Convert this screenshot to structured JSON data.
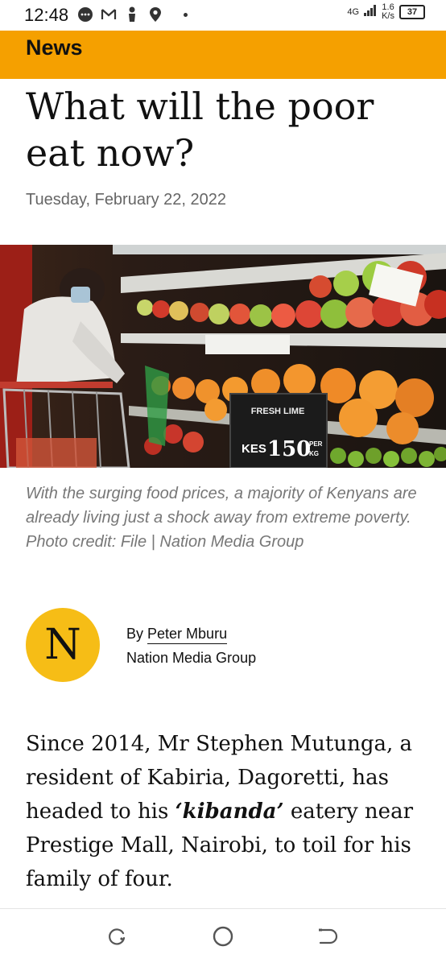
{
  "status_bar": {
    "time": "12:48",
    "network_type": "4G",
    "speed_value": "1.6",
    "speed_unit": "K/s",
    "battery": "37"
  },
  "section": {
    "label": "News"
  },
  "article": {
    "headline": "What will the poor eat now?",
    "date": "Tuesday, February 22, 2022",
    "photo": {
      "sign_title": "FRESH LIME",
      "sign_currency": "KES",
      "sign_price": "150",
      "sign_per": "PER",
      "sign_unit": "KG"
    },
    "caption": "With the surging food prices, a majority of Kenyans are already living just a shock away from extreme poverty. Photo credit: File | Nation Media Group",
    "author": {
      "logo_letter": "N",
      "by_prefix": "By",
      "name": "Peter Mburu",
      "publisher": "Nation Media Group"
    },
    "body": {
      "part1": "Since 2014, Mr Stephen Mutunga, a resident of Kabiria, Dagoretti, has headed to his ",
      "italic": "‘kibanda’",
      "part2": " eatery near Prestige Mall, Nairobi, to toil for his family of four."
    }
  },
  "colors": {
    "accent": "#f5a000",
    "logo": "#f6bd16",
    "caption": "#777777",
    "date": "#666666"
  },
  "nav": {
    "icons": [
      "recent-apps-icon",
      "home-icon",
      "back-icon"
    ]
  }
}
